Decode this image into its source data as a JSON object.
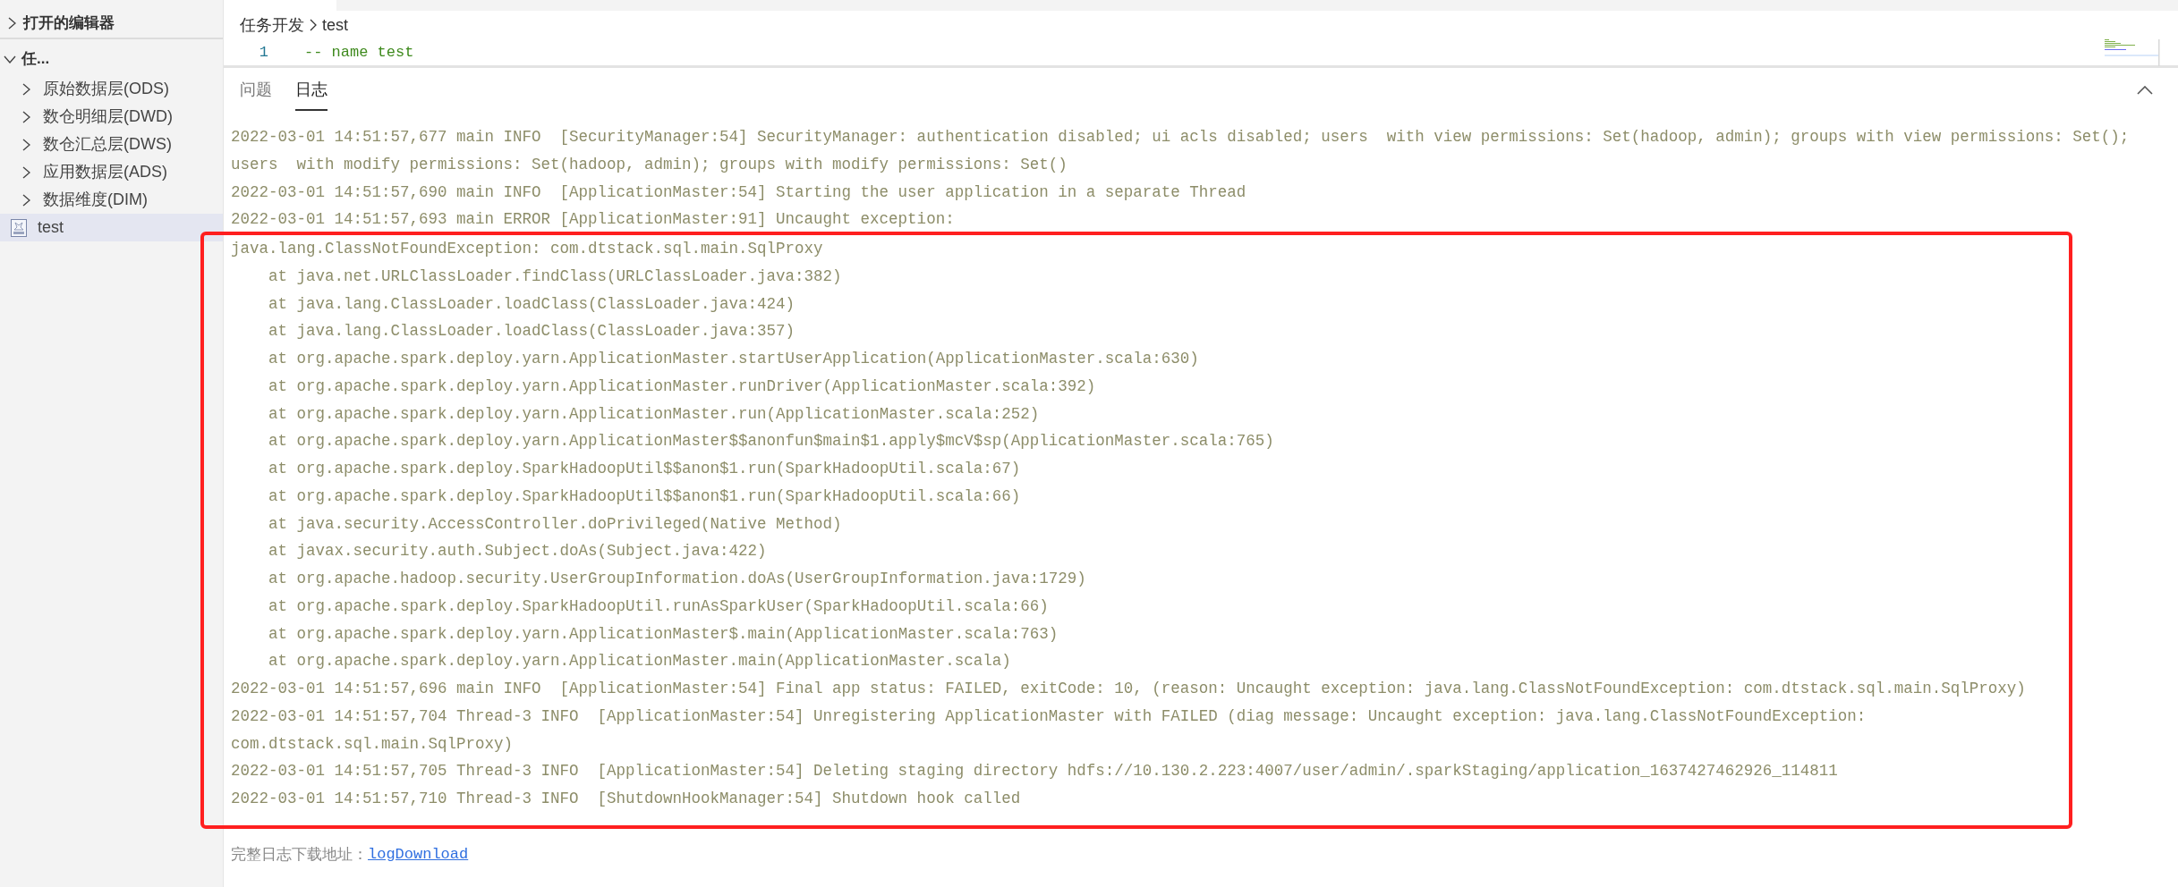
{
  "sidebar": {
    "open_editors": {
      "label": "打开的编辑器",
      "expanded": false
    },
    "tree": {
      "label": "任...",
      "expanded": true,
      "children": [
        {
          "label": "原始数据层(ODS)",
          "kind": "folder",
          "expanded": false,
          "selected": false
        },
        {
          "label": "数仓明细层(DWD)",
          "kind": "folder",
          "expanded": false,
          "selected": false
        },
        {
          "label": "数仓汇总层(DWS)",
          "kind": "folder",
          "expanded": false,
          "selected": false
        },
        {
          "label": "应用数据层(ADS)",
          "kind": "folder",
          "expanded": false,
          "selected": false
        },
        {
          "label": "数据维度(DIM)",
          "kind": "folder",
          "expanded": false,
          "selected": false
        },
        {
          "label": "test",
          "kind": "file",
          "selected": true
        }
      ]
    }
  },
  "editor": {
    "breadcrumb": [
      "任务开发",
      "test"
    ],
    "lines": [
      {
        "number": "1",
        "text": "-- name test"
      }
    ]
  },
  "panel": {
    "tabs": [
      {
        "label": "问题",
        "selected": false
      },
      {
        "label": "日志",
        "selected": true
      }
    ],
    "log": [
      "2022-03-01 14:51:57,677 main INFO  [SecurityManager:54] SecurityManager: authentication disabled; ui acls disabled; users  with view permissions: Set(hadoop, admin); groups with view permissions: Set(); users  with modify permissions: Set(hadoop, admin); groups with modify permissions: Set()",
      "2022-03-01 14:51:57,690 main INFO  [ApplicationMaster:54] Starting the user application in a separate Thread",
      "2022-03-01 14:51:57,693 main ERROR [ApplicationMaster:91] Uncaught exception:"
    ],
    "highlighted_log": [
      "java.lang.ClassNotFoundException: com.dtstack.sql.main.SqlProxy",
      "    at java.net.URLClassLoader.findClass(URLClassLoader.java:382)",
      "    at java.lang.ClassLoader.loadClass(ClassLoader.java:424)",
      "    at java.lang.ClassLoader.loadClass(ClassLoader.java:357)",
      "    at org.apache.spark.deploy.yarn.ApplicationMaster.startUserApplication(ApplicationMaster.scala:630)",
      "    at org.apache.spark.deploy.yarn.ApplicationMaster.runDriver(ApplicationMaster.scala:392)",
      "    at org.apache.spark.deploy.yarn.ApplicationMaster.run(ApplicationMaster.scala:252)",
      "    at org.apache.spark.deploy.yarn.ApplicationMaster$$anonfun$main$1.apply$mcV$sp(ApplicationMaster.scala:765)",
      "    at org.apache.spark.deploy.SparkHadoopUtil$$anon$1.run(SparkHadoopUtil.scala:67)",
      "    at org.apache.spark.deploy.SparkHadoopUtil$$anon$1.run(SparkHadoopUtil.scala:66)",
      "    at java.security.AccessController.doPrivileged(Native Method)",
      "    at javax.security.auth.Subject.doAs(Subject.java:422)",
      "    at org.apache.hadoop.security.UserGroupInformation.doAs(UserGroupInformation.java:1729)",
      "    at org.apache.spark.deploy.SparkHadoopUtil.runAsSparkUser(SparkHadoopUtil.scala:66)",
      "    at org.apache.spark.deploy.yarn.ApplicationMaster$.main(ApplicationMaster.scala:763)",
      "    at org.apache.spark.deploy.yarn.ApplicationMaster.main(ApplicationMaster.scala)",
      "2022-03-01 14:51:57,696 main INFO  [ApplicationMaster:54] Final app status: FAILED, exitCode: 10, (reason: Uncaught exception: java.lang.ClassNotFoundException: com.dtstack.sql.main.SqlProxy)",
      "2022-03-01 14:51:57,704 Thread-3 INFO  [ApplicationMaster:54] Unregistering ApplicationMaster with FAILED (diag message: Uncaught exception: java.lang.ClassNotFoundException: com.dtstack.sql.main.SqlProxy)",
      "2022-03-01 14:51:57,705 Thread-3 INFO  [ApplicationMaster:54] Deleting staging directory hdfs://10.130.2.223:4007/user/admin/.sparkStaging/application_1637427462926_114811",
      "2022-03-01 14:51:57,710 Thread-3 INFO  [ShutdownHookManager:54] Shutdown hook called"
    ],
    "footer": {
      "label": "完整日志下载地址：",
      "link": "logDownload"
    }
  }
}
